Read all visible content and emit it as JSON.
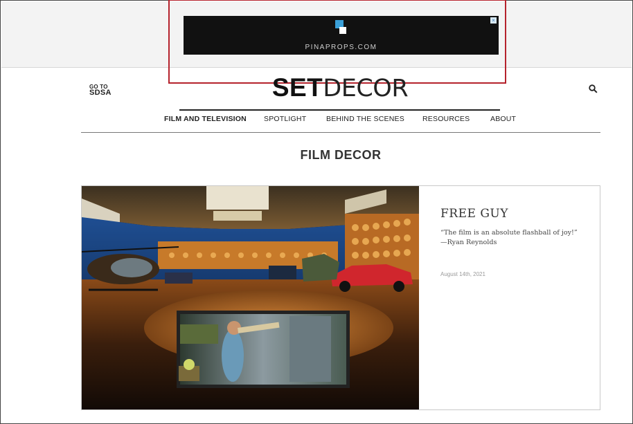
{
  "ad": {
    "logo_letters": "pq",
    "text": "PINAPROPS.COM",
    "close_glyph": "×"
  },
  "header": {
    "go_to_small": "GO TO",
    "go_to_big": "SDSA",
    "brand_strong": "SET",
    "brand_light": "DECOR"
  },
  "nav": {
    "items": [
      {
        "label": "FILM AND TELEVISION",
        "active": true
      },
      {
        "label": "SPOTLIGHT"
      },
      {
        "label": "BEHIND THE SCENES"
      },
      {
        "label": "RESOURCES"
      },
      {
        "label": "ABOUT"
      }
    ]
  },
  "section": {
    "title": "FILM DECOR"
  },
  "feature": {
    "title": "FREE GUY",
    "quote_line1": "“The film is an absolute flashball of joy!”",
    "quote_line2": "—Ryan Reynolds",
    "date": "August 14th, 2021"
  },
  "colors": {
    "highlight_box": "#b5222c",
    "ad_background": "#111111",
    "ad_logo_blue": "#3aa0d8"
  },
  "icons": {
    "search": "search-icon",
    "close": "close-icon"
  }
}
